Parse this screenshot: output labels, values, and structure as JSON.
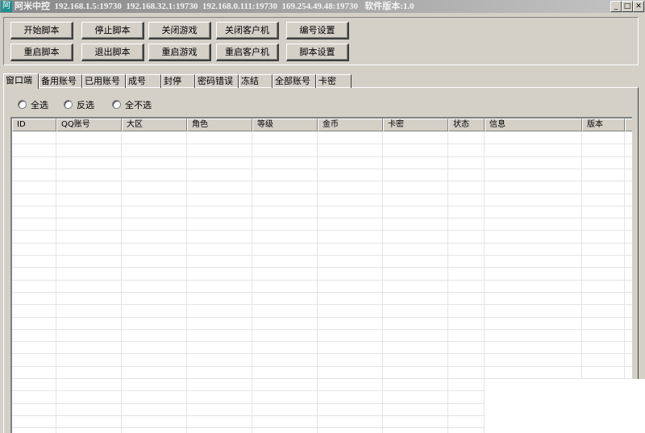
{
  "titlebar": {
    "title": "阿米中控  192.168.1.5:19730  192.168.32.1:19730  192.168.0.111:19730  169.254.49.48:19730   软件版本:1.0",
    "icon": "app-logo-icon",
    "minimize": "_",
    "maximize": "□",
    "close": "✕"
  },
  "toolbar": {
    "row1": [
      "开始脚本",
      "停止脚本",
      "关闭游戏",
      "关闭客户机",
      "编号设置"
    ],
    "row2": [
      "重启脚本",
      "退出脚本",
      "重启游戏",
      "重启客户机",
      "脚本设置"
    ]
  },
  "tabs": [
    "窗口端",
    "备用账号",
    "已用账号",
    "成号",
    "封停",
    "密码错误",
    "冻结",
    "全部账号",
    "卡密"
  ],
  "active_tab": "窗口端",
  "filter": {
    "options": [
      "全选",
      "反选",
      "全不选"
    ]
  },
  "table": {
    "columns": [
      "ID",
      "QQ账号",
      "大区",
      "角色",
      "等级",
      "金币",
      "卡密",
      "状态",
      "信息",
      "版本"
    ],
    "rows": []
  }
}
